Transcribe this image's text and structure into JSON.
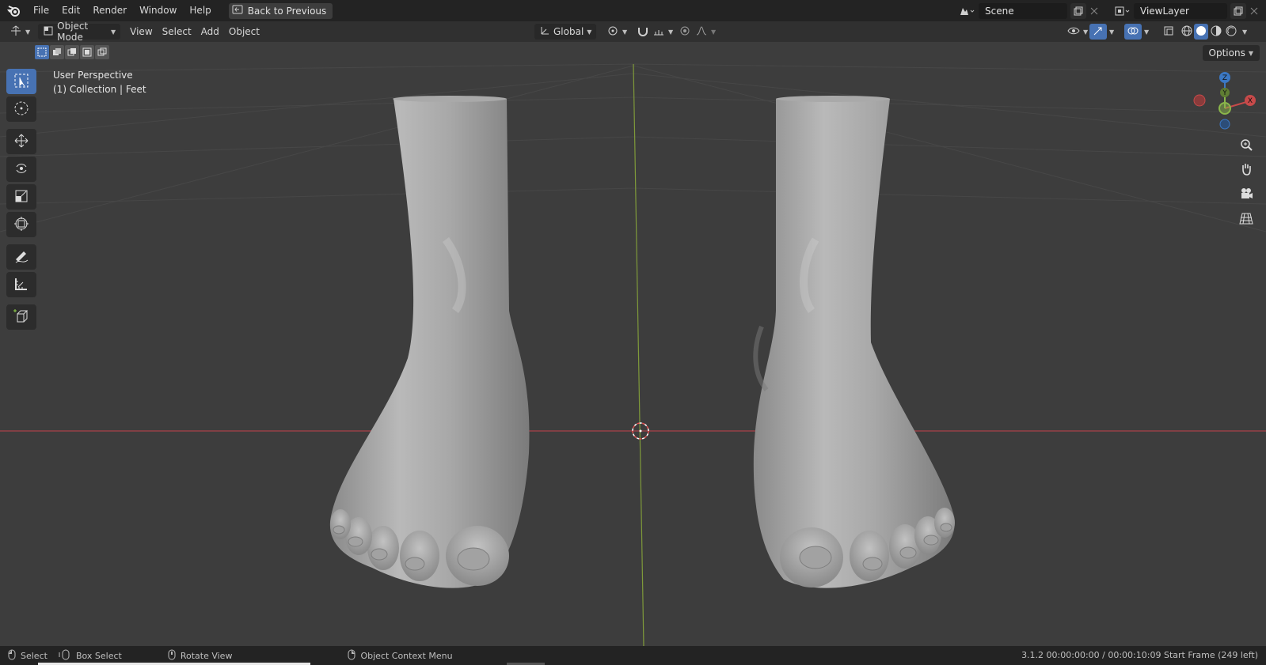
{
  "topbar": {
    "menus": [
      "File",
      "Edit",
      "Render",
      "Window",
      "Help"
    ],
    "back_button": "Back to Previous",
    "scene": "Scene",
    "view_layer": "ViewLayer"
  },
  "header": {
    "mode": "Object Mode",
    "menus": [
      "View",
      "Select",
      "Add",
      "Object"
    ],
    "transform_orientation": "Global"
  },
  "viewport": {
    "perspective": "User Perspective",
    "collection": "(1) Collection | Feet",
    "options_label": "Options",
    "gizmo": {
      "z": "Z",
      "y": "Y",
      "x": "X"
    }
  },
  "statusbar": {
    "select": "Select",
    "box_select": "Box Select",
    "rotate_view": "Rotate View",
    "context_menu": "Object Context Menu",
    "info": "3.1.2   00:00:00:00 / 00:00:10:09   Start Frame (249 left)"
  },
  "colors": {
    "accent": "#4772b3",
    "x_axis": "#c74a4a",
    "y_axis": "#8ab64a",
    "z_axis": "#3b78c4"
  }
}
